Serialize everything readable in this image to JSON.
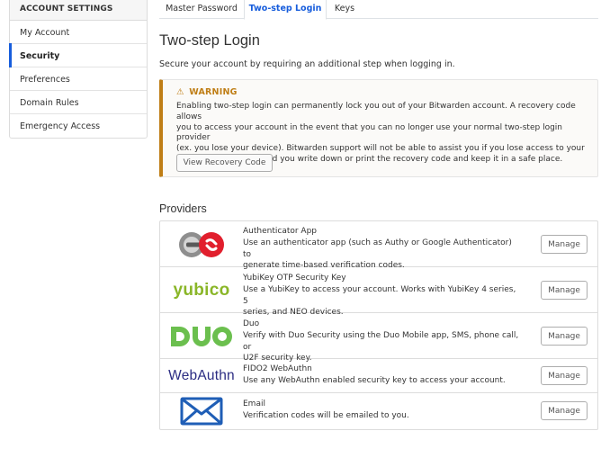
{
  "sidebar": {
    "header": "ACCOUNT SETTINGS",
    "items": [
      {
        "label": "My Account"
      },
      {
        "label": "Security"
      },
      {
        "label": "Preferences"
      },
      {
        "label": "Domain Rules"
      },
      {
        "label": "Emergency Access"
      }
    ],
    "active_index": 1
  },
  "tabs": [
    {
      "label": "Master Password"
    },
    {
      "label": "Two-step Login"
    },
    {
      "label": "Keys"
    }
  ],
  "page": {
    "title": "Two-step Login",
    "description": "Secure your account by requiring an additional step when logging in."
  },
  "warning": {
    "icon": "warning-triangle-icon",
    "title": "WARNING",
    "lines": [
      "Enabling two-step login can permanently lock you out of your Bitwarden account. A recovery code allows",
      "you to access your account in the event that you can no longer use your normal two-step login provider",
      "(ex. you lose your device). Bitwarden support will not be able to assist you if you lose access to your",
      "account. We recommend you write down or print the recovery code and keep it in a safe place."
    ],
    "button_label": "View Recovery Code"
  },
  "providers": {
    "heading": "Providers",
    "manage_label": "Manage",
    "items": [
      {
        "name": "Authenticator App",
        "lines": [
          "Use an authenticator app (such as Authy or Google Authenticator) to",
          "generate time-based verification codes."
        ],
        "logo": "authenticator-app-icon"
      },
      {
        "name": "YubiKey OTP Security Key",
        "lines": [
          "Use a YubiKey to access your account. Works with YubiKey 4 series, 5",
          "series, and NEO devices."
        ],
        "logo_text": "yubico"
      },
      {
        "name": "Duo",
        "lines": [
          "Verify with Duo Security using the Duo Mobile app, SMS, phone call, or",
          "U2F security key."
        ],
        "logo": "duo-logo"
      },
      {
        "name": "FIDO2 WebAuthn",
        "lines": [
          "Use any WebAuthn enabled security key to access your account."
        ],
        "logo_text": "WebAuthn"
      },
      {
        "name": "Email",
        "lines": [
          "Verification codes will be emailed to you."
        ],
        "logo": "envelope-icon"
      }
    ]
  },
  "colors": {
    "accent": "#175ddc",
    "warning": "#bf7e16",
    "yubico_green": "#8ab628",
    "duo_green": "#6bbf4e",
    "webauthn_navy": "#2c2d83",
    "email_blue": "#1f5eb6",
    "authy_red": "#e11f2d"
  }
}
